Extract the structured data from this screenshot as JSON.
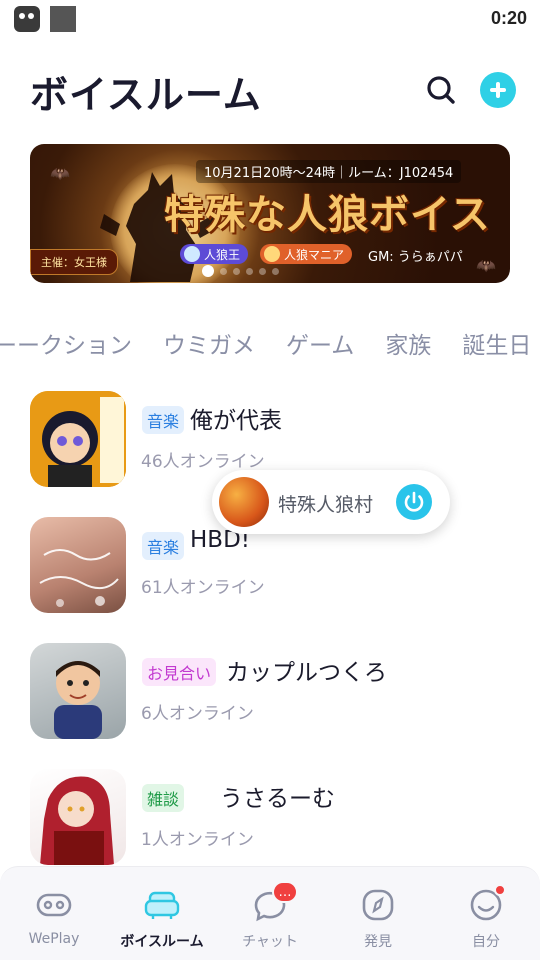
{
  "status_bar": {
    "time": "0:20"
  },
  "header": {
    "title": "ボイスルーム"
  },
  "banner": {
    "info": "10月21日20時～24時｜ルーム：J102454",
    "title": "特殊な人狼ボイス",
    "host": "主催：女王様",
    "badges": [
      "人狼王",
      "人狼マニア"
    ],
    "gm": "GM: うらぁパパ"
  },
  "categories": [
    "ーークション",
    "ウミガメ",
    "ゲーム",
    "家族",
    "誕生日"
  ],
  "rooms": [
    {
      "tag": "音楽",
      "name": "俺が代表",
      "online": "46人オンライン",
      "tag_color": "#2b7fe0"
    },
    {
      "tag": "音楽",
      "name": "HBD!",
      "online": "61人オンライン",
      "tag_color": "#2b7fe0"
    },
    {
      "tag": "お見合い",
      "name": "カップルつくろ",
      "online": "6人オンライン",
      "tag_color": "#c23ad0"
    },
    {
      "tag": "雑談",
      "name": "うさるーむ",
      "online": "1人オンライン",
      "tag_color": "#1d9a46"
    }
  ],
  "mini_player": {
    "room_name": "特殊人狼村"
  },
  "bottom_nav": {
    "items": [
      {
        "label": "WePlay",
        "icon": "gamepad-icon"
      },
      {
        "label": "ボイスルーム",
        "icon": "sofa-icon"
      },
      {
        "label": "チャット",
        "icon": "chat-bubble-icon"
      },
      {
        "label": "発見",
        "icon": "compass-icon"
      },
      {
        "label": "自分",
        "icon": "smile-face-icon"
      }
    ],
    "active": "ボイスルーム",
    "chat_badge": "…"
  },
  "colors": {
    "accent": "#2fd0e6",
    "badge": "#f0403f",
    "text": "#1a1a2e",
    "muted": "#9a9aae"
  }
}
